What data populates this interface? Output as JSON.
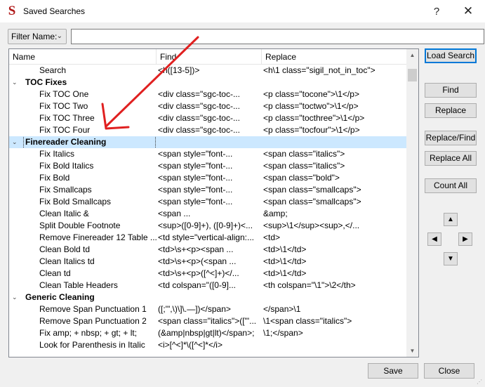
{
  "window": {
    "title": "Saved Searches",
    "app_icon_glyph": "S"
  },
  "titlebar": {
    "help_glyph": "?",
    "close_glyph": "✕"
  },
  "filter": {
    "label": "Filter Name:",
    "value": ""
  },
  "columns": {
    "name": "Name",
    "find": "Find",
    "replace": "Replace"
  },
  "rows": [
    {
      "kind": "item",
      "name": "Search",
      "find": "<h([13-5])>",
      "replace": "<h\\1 class=\"sigil_not_in_toc\">"
    },
    {
      "kind": "group",
      "name": "TOC Fixes",
      "find": "",
      "replace": ""
    },
    {
      "kind": "item",
      "name": "Fix TOC One",
      "find": "<div class=\"sgc-toc-...",
      "replace": "<p class=\"tocone\">\\1</p>"
    },
    {
      "kind": "item",
      "name": "Fix TOC Two",
      "find": "<div class=\"sgc-toc-...",
      "replace": "<p class=\"toctwo\">\\1</p>"
    },
    {
      "kind": "item",
      "name": "Fix TOC Three",
      "find": "<div class=\"sgc-toc-...",
      "replace": "<p class=\"tocthree\">\\1</p>"
    },
    {
      "kind": "item",
      "name": "Fix TOC Four",
      "find": "<div class=\"sgc-toc-...",
      "replace": "<p class=\"tocfour\">\\1</p>"
    },
    {
      "kind": "group",
      "name": "Finereader Cleaning",
      "find": "",
      "replace": "",
      "selected": true
    },
    {
      "kind": "item",
      "name": "Fix Italics",
      "find": "<span style=\"font-...",
      "replace": "<span class=\"italics\">"
    },
    {
      "kind": "item",
      "name": "Fix Bold Italics",
      "find": "<span style=\"font-...",
      "replace": "<span class=\"italics\">"
    },
    {
      "kind": "item",
      "name": "Fix Bold",
      "find": "<span style=\"font-...",
      "replace": "<span class=\"bold\">"
    },
    {
      "kind": "item",
      "name": "Fix Smallcaps",
      "find": "<span style=\"font-...",
      "replace": "<span class=\"smallcaps\">"
    },
    {
      "kind": "item",
      "name": "Fix Bold Smallcaps",
      "find": "<span style=\"font-...",
      "replace": "<span class=\"smallcaps\">"
    },
    {
      "kind": "item",
      "name": "Clean Italic &",
      "find": "<span ...",
      "replace": "&amp;"
    },
    {
      "kind": "item",
      "name": "Split Double Footnote",
      "find": "<sup>([0-9]+), ([0-9]+)<...",
      "replace": "<sup>\\1</sup><sup>,</..."
    },
    {
      "kind": "item",
      "name": "Remove Finereader 12 Table ...",
      "find": "<td style=\"vertical-align:...",
      "replace": "<td>"
    },
    {
      "kind": "item",
      "name": "Clean Bold td",
      "find": "<td>\\s+<p><span ...",
      "replace": "<td>\\1</td>"
    },
    {
      "kind": "item",
      "name": "Clean Italics td",
      "find": "<td>\\s+<p>(<span ...",
      "replace": "<td>\\1</td>"
    },
    {
      "kind": "item",
      "name": "Clean td",
      "find": "<td>\\s+<p>([^<]+)</...",
      "replace": "<td>\\1</td>"
    },
    {
      "kind": "item",
      "name": "Clean Table Headers",
      "find": "<td colspan=\"([0-9]...",
      "replace": "<th colspan=\"\\1\">\\2</th>"
    },
    {
      "kind": "group",
      "name": "Generic Cleaning",
      "find": "",
      "replace": ""
    },
    {
      "kind": "item",
      "name": "Remove Span Punctuation 1",
      "find": "([;'\",\\)\\]\\.—])</span>",
      "replace": "</span>\\1"
    },
    {
      "kind": "item",
      "name": "Remove Span Punctuation 2",
      "find": "<span class=\"italics\">([\"'...",
      "replace": "\\1<span class=\"italics\">"
    },
    {
      "kind": "item",
      "name": "Fix amp; + nbsp; + gt; + lt;",
      "find": "(&amp|nbsp|gt|lt)</span>;",
      "replace": "\\1;</span>"
    },
    {
      "kind": "item",
      "name": "Look for Parenthesis in Italic",
      "find": "<i>[^<]*\\([^<]*</i>",
      "replace": ""
    }
  ],
  "buttons": {
    "load_search": "Load Search",
    "find": "Find",
    "replace": "Replace",
    "replace_find": "Replace/Find",
    "replace_all": "Replace All",
    "count_all": "Count All",
    "save": "Save",
    "close": "Close"
  },
  "arrows": {
    "up": "▲",
    "down": "▼",
    "left": "◀",
    "right": "▶"
  },
  "scrollbar": {
    "up": "▲",
    "down": "▼"
  },
  "colors": {
    "selection": "#cce8ff",
    "annotation_arrow": "#e02020",
    "default_button_border": "#0078d7",
    "app_icon": "#b01818"
  }
}
